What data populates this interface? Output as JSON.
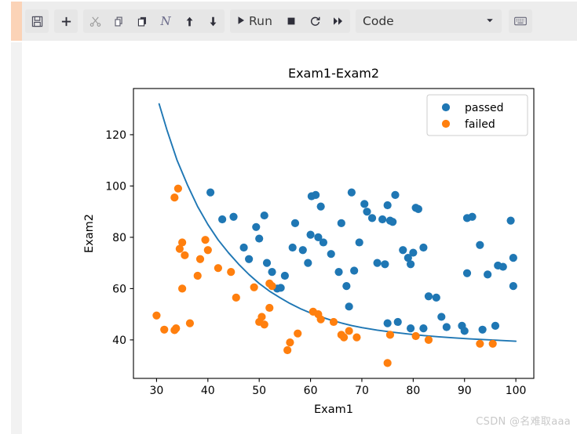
{
  "toolbar": {
    "groups": [
      {
        "name": "file",
        "buttons": [
          {
            "name": "save-button",
            "icon": "save-icon",
            "label": "",
            "dim": false
          }
        ]
      },
      {
        "name": "insert",
        "buttons": [
          {
            "name": "insert-cell-button",
            "icon": "plus-icon",
            "label": "",
            "dim": false
          }
        ]
      },
      {
        "name": "edit",
        "buttons": [
          {
            "name": "cut-button",
            "icon": "scissors-icon",
            "label": "",
            "dim": true
          },
          {
            "name": "copy-button",
            "icon": "copy-icon",
            "label": "",
            "dim": false
          },
          {
            "name": "paste-button",
            "icon": "paste-icon",
            "label": "",
            "dim": false
          },
          {
            "name": "format-button",
            "icon": "italic-n-icon",
            "label": "N",
            "dim": false
          },
          {
            "name": "move-up-button",
            "icon": "arrow-up-icon",
            "label": "",
            "dim": false
          },
          {
            "name": "move-down-button",
            "icon": "arrow-down-icon",
            "label": "",
            "dim": false
          }
        ]
      }
    ],
    "run_label": "Run",
    "run_icon": "play-icon",
    "interrupt_icon": "stop-square-icon",
    "restart_icon": "restart-circle-icon",
    "restart_run_all_icon": "fast-forward-icon",
    "cell_type": "Code",
    "cell_type_caret": "chevron-down-icon",
    "keyboard_icon": "keyboard-icon"
  },
  "watermark": "CSDN @名难取aaa",
  "chart_data": {
    "type": "scatter",
    "title": "Exam1-Exam2",
    "xlabel": "Exam1",
    "ylabel": "Exam2",
    "xlim": [
      25.5,
      103.5
    ],
    "ylim": [
      25.0,
      138.0
    ],
    "xticks": [
      30,
      40,
      50,
      60,
      70,
      80,
      90,
      100
    ],
    "yticks": [
      40,
      60,
      80,
      100,
      120
    ],
    "grid": false,
    "legend_position": "upper right",
    "colors": {
      "passed": "#1f77b4",
      "failed": "#ff7f0e",
      "boundary": "#1f77b4"
    },
    "series": [
      {
        "name": "passed",
        "color": "#1f77b4",
        "marker": "o",
        "points": [
          [
            40.5,
            97.5
          ],
          [
            42.8,
            87.0
          ],
          [
            45.0,
            88.0
          ],
          [
            49.4,
            84.0
          ],
          [
            47.0,
            76.0
          ],
          [
            48.0,
            71.5
          ],
          [
            50.0,
            79.5
          ],
          [
            51.5,
            70.0
          ],
          [
            51.0,
            88.5
          ],
          [
            52.5,
            66.5
          ],
          [
            53.5,
            60.0
          ],
          [
            54.2,
            60.3
          ],
          [
            55.0,
            65.0
          ],
          [
            56.5,
            76.0
          ],
          [
            57.0,
            85.5
          ],
          [
            58.5,
            75.0
          ],
          [
            59.5,
            70.0
          ],
          [
            60.2,
            96.0
          ],
          [
            61.0,
            96.5
          ],
          [
            60.0,
            81.0
          ],
          [
            61.5,
            80.0
          ],
          [
            62.0,
            92.0
          ],
          [
            62.5,
            78.0
          ],
          [
            64.0,
            73.5
          ],
          [
            65.5,
            66.5
          ],
          [
            66.0,
            85.5
          ],
          [
            67.0,
            61.0
          ],
          [
            68.0,
            97.5
          ],
          [
            67.5,
            53.0
          ],
          [
            69.5,
            78.0
          ],
          [
            70.5,
            93.0
          ],
          [
            71.0,
            90.0
          ],
          [
            72.0,
            87.5
          ],
          [
            73.0,
            70.0
          ],
          [
            74.0,
            87.0
          ],
          [
            75.0,
            92.5
          ],
          [
            75.5,
            86.5
          ],
          [
            76.0,
            86.0
          ],
          [
            76.5,
            96.5
          ],
          [
            78.0,
            75.0
          ],
          [
            79.0,
            72.0
          ],
          [
            79.5,
            69.5
          ],
          [
            80.0,
            74.0
          ],
          [
            80.5,
            91.5
          ],
          [
            81.0,
            91.0
          ],
          [
            82.0,
            76.0
          ],
          [
            83.0,
            57.0
          ],
          [
            84.5,
            56.5
          ],
          [
            85.5,
            49.0
          ],
          [
            75.0,
            46.5
          ],
          [
            77.0,
            47.0
          ],
          [
            79.5,
            44.5
          ],
          [
            82.0,
            44.5
          ],
          [
            86.5,
            45.0
          ],
          [
            89.5,
            45.5
          ],
          [
            90.0,
            43.5
          ],
          [
            90.5,
            87.5
          ],
          [
            91.5,
            88.0
          ],
          [
            93.0,
            77.0
          ],
          [
            90.5,
            66.0
          ],
          [
            94.5,
            65.5
          ],
          [
            96.5,
            69.0
          ],
          [
            97.5,
            68.5
          ],
          [
            99.0,
            86.5
          ],
          [
            99.5,
            72.0
          ],
          [
            99.5,
            61.0
          ],
          [
            93.5,
            44.0
          ],
          [
            96.0,
            45.5
          ],
          [
            74.5,
            69.5
          ],
          [
            68.5,
            67.0
          ]
        ]
      },
      {
        "name": "failed",
        "color": "#ff7f0e",
        "marker": "o",
        "points": [
          [
            30.0,
            49.5
          ],
          [
            31.5,
            44.0
          ],
          [
            33.5,
            43.8
          ],
          [
            33.8,
            44.5
          ],
          [
            34.2,
            99.0
          ],
          [
            33.5,
            95.5
          ],
          [
            34.5,
            75.5
          ],
          [
            35.0,
            78.0
          ],
          [
            35.5,
            73.0
          ],
          [
            36.5,
            46.5
          ],
          [
            35.0,
            60.0
          ],
          [
            38.5,
            71.5
          ],
          [
            38.0,
            65.0
          ],
          [
            39.5,
            79.0
          ],
          [
            40.0,
            75.0
          ],
          [
            42.0,
            68.0
          ],
          [
            44.5,
            66.5
          ],
          [
            45.5,
            56.5
          ],
          [
            49.0,
            60.5
          ],
          [
            50.0,
            47.0
          ],
          [
            50.5,
            49.0
          ],
          [
            51.0,
            46.0
          ],
          [
            52.0,
            62.0
          ],
          [
            52.5,
            61.0
          ],
          [
            52.0,
            52.5
          ],
          [
            55.5,
            36.0
          ],
          [
            56.0,
            39.0
          ],
          [
            57.5,
            42.5
          ],
          [
            60.5,
            51.0
          ],
          [
            61.5,
            50.0
          ],
          [
            62.0,
            48.0
          ],
          [
            64.5,
            47.0
          ],
          [
            66.0,
            42.0
          ],
          [
            66.5,
            41.0
          ],
          [
            67.5,
            43.5
          ],
          [
            69.0,
            41.0
          ],
          [
            75.0,
            31.0
          ],
          [
            75.5,
            42.0
          ],
          [
            80.5,
            41.5
          ],
          [
            83.0,
            40.0
          ],
          [
            93.0,
            38.5
          ],
          [
            95.5,
            38.5
          ]
        ]
      }
    ],
    "boundary_curve": {
      "name": "decision boundary",
      "color": "#1f77b4",
      "points": [
        [
          30.5,
          132.0
        ],
        [
          32.0,
          122.0
        ],
        [
          34.0,
          110.0
        ],
        [
          36.0,
          100.5
        ],
        [
          38.0,
          92.0
        ],
        [
          40.0,
          85.0
        ],
        [
          42.0,
          79.0
        ],
        [
          44.0,
          74.0
        ],
        [
          46.0,
          69.5
        ],
        [
          48.0,
          65.5
        ],
        [
          50.0,
          62.0
        ],
        [
          52.0,
          59.0
        ],
        [
          54.0,
          56.5
        ],
        [
          56.0,
          54.2
        ],
        [
          58.0,
          52.2
        ],
        [
          60.0,
          50.5
        ],
        [
          62.0,
          49.0
        ],
        [
          64.0,
          47.7
        ],
        [
          66.0,
          46.6
        ],
        [
          68.0,
          45.6
        ],
        [
          70.0,
          44.8
        ],
        [
          73.0,
          43.8
        ],
        [
          76.0,
          43.0
        ],
        [
          79.0,
          42.3
        ],
        [
          82.0,
          41.7
        ],
        [
          85.0,
          41.2
        ],
        [
          88.0,
          40.8
        ],
        [
          91.0,
          40.4
        ],
        [
          94.0,
          40.1
        ],
        [
          97.0,
          39.8
        ],
        [
          100.0,
          39.5
        ]
      ]
    },
    "legend": [
      {
        "label": "passed",
        "color": "#1f77b4"
      },
      {
        "label": "failed",
        "color": "#ff7f0e"
      }
    ]
  }
}
